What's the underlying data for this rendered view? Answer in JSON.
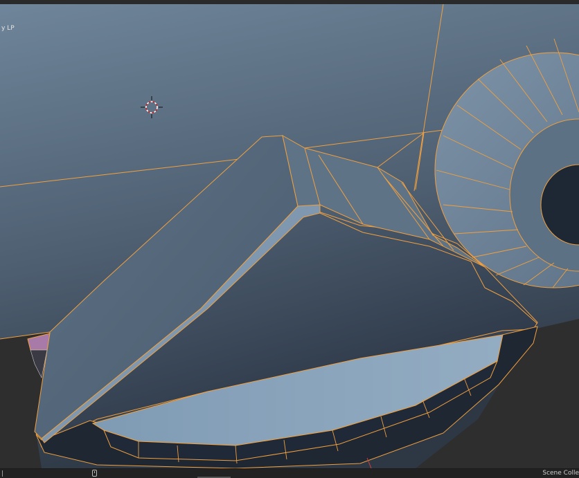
{
  "viewport": {
    "object_label": "y LP",
    "wire_color": "#f0a040",
    "background_color": "#6c8197"
  },
  "status_bar": {
    "scene_collection_label": "Scene Colle",
    "mouse_icon": "mouse-icon"
  },
  "icons": {
    "cursor": "3d-cursor-icon"
  }
}
